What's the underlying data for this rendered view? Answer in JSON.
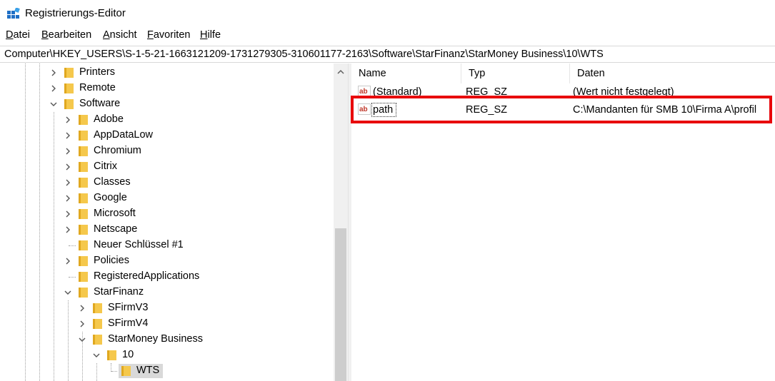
{
  "window": {
    "title": "Registrierungs-Editor",
    "icon": "registry-editor-icon"
  },
  "menu": [
    "Datei",
    "Bearbeiten",
    "Ansicht",
    "Favoriten",
    "Hilfe"
  ],
  "address": "Computer\\HKEY_USERS\\S-1-5-21-1663121209-1731279305-310601177-2163\\Software\\StarFinanz\\StarMoney Business\\10\\WTS",
  "tree": [
    {
      "label": "Printers",
      "expander": "collapsed"
    },
    {
      "label": "Remote",
      "expander": "collapsed"
    },
    {
      "label": "Software",
      "expander": "expanded"
    },
    {
      "label": "Adobe",
      "expander": "collapsed"
    },
    {
      "label": "AppDataLow",
      "expander": "collapsed"
    },
    {
      "label": "Chromium",
      "expander": "collapsed"
    },
    {
      "label": "Citrix",
      "expander": "collapsed"
    },
    {
      "label": "Classes",
      "expander": "collapsed"
    },
    {
      "label": "Google",
      "expander": "collapsed"
    },
    {
      "label": "Microsoft",
      "expander": "collapsed"
    },
    {
      "label": "Netscape",
      "expander": "collapsed"
    },
    {
      "label": "Neuer Schlüssel #1",
      "expander": "none"
    },
    {
      "label": "Policies",
      "expander": "collapsed"
    },
    {
      "label": "RegisteredApplications",
      "expander": "none"
    },
    {
      "label": "StarFinanz",
      "expander": "expanded"
    },
    {
      "label": "SFirmV3",
      "expander": "collapsed"
    },
    {
      "label": "SFirmV4",
      "expander": "collapsed"
    },
    {
      "label": "StarMoney Business",
      "expander": "expanded"
    },
    {
      "label": "10",
      "expander": "expanded"
    },
    {
      "label": "WTS",
      "expander": "none",
      "selected": true
    }
  ],
  "list": {
    "columns": [
      "Name",
      "Typ",
      "Daten"
    ],
    "rows": [
      {
        "name": "(Standard)",
        "type": "REG_SZ",
        "data": "(Wert nicht festgelegt)"
      },
      {
        "name": "path",
        "type": "REG_SZ",
        "data": "C:\\Mandanten für SMB 10\\Firma A\\profil",
        "highlighted": true
      }
    ]
  },
  "colors": {
    "highlight_border": "#e8060b",
    "folder": "#f5c84c",
    "selection": "#d9d9d9"
  }
}
